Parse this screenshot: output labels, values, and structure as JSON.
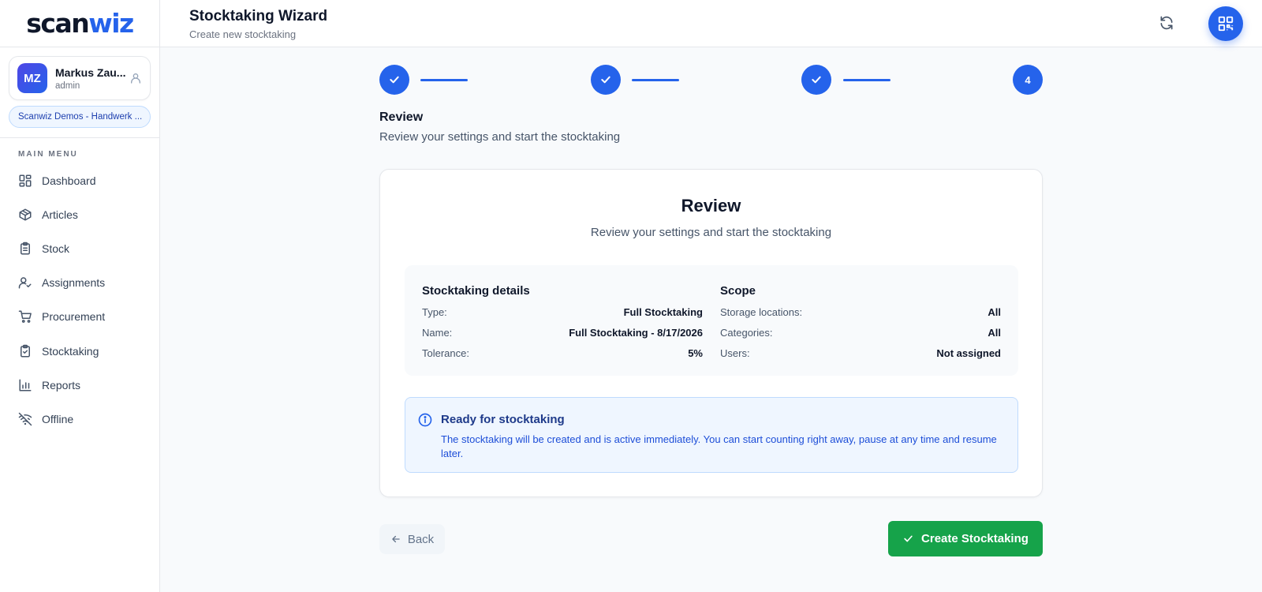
{
  "app": {
    "logo_part1": "scan",
    "logo_part2": "wiz"
  },
  "user": {
    "initials": "MZ",
    "name": "Markus Zau...",
    "role": "admin",
    "org": "Scanwiz Demos - Handwerk ..."
  },
  "sidebar": {
    "heading": "MAIN MENU",
    "items": [
      {
        "label": "Dashboard",
        "icon": "dashboard-icon"
      },
      {
        "label": "Articles",
        "icon": "box-icon"
      },
      {
        "label": "Stock",
        "icon": "clipboard-list-icon"
      },
      {
        "label": "Assignments",
        "icon": "user-check-icon"
      },
      {
        "label": "Procurement",
        "icon": "cart-icon"
      },
      {
        "label": "Stocktaking",
        "icon": "clipboard-check-icon"
      },
      {
        "label": "Reports",
        "icon": "bar-chart-icon"
      },
      {
        "label": "Offline",
        "icon": "wifi-off-icon"
      }
    ]
  },
  "header": {
    "title": "Stocktaking Wizard",
    "subtitle": "Create new stocktaking"
  },
  "stepper": {
    "current_step": "4",
    "completed_steps": 3
  },
  "section": {
    "title": "Review",
    "subtitle": "Review your settings and start the stocktaking"
  },
  "card": {
    "title": "Review",
    "subtitle": "Review your settings and start the stocktaking",
    "details": {
      "title": "Stocktaking details",
      "rows": [
        {
          "label": "Type:",
          "value": "Full Stocktaking"
        },
        {
          "label": "Name:",
          "value": "Full Stocktaking - 8/17/2026"
        },
        {
          "label": "Tolerance:",
          "value": "5%"
        }
      ]
    },
    "scope": {
      "title": "Scope",
      "rows": [
        {
          "label": "Storage locations:",
          "value": "All"
        },
        {
          "label": "Categories:",
          "value": "All"
        },
        {
          "label": "Users:",
          "value": "Not assigned"
        }
      ]
    },
    "info": {
      "title": "Ready for stocktaking",
      "text": "The stocktaking will be created and is active immediately. You can start counting right away, pause at any time and resume later."
    }
  },
  "actions": {
    "back_label": "Back",
    "create_label": "Create Stocktaking"
  },
  "colors": {
    "accent": "#2563eb",
    "success": "#16a34a"
  }
}
